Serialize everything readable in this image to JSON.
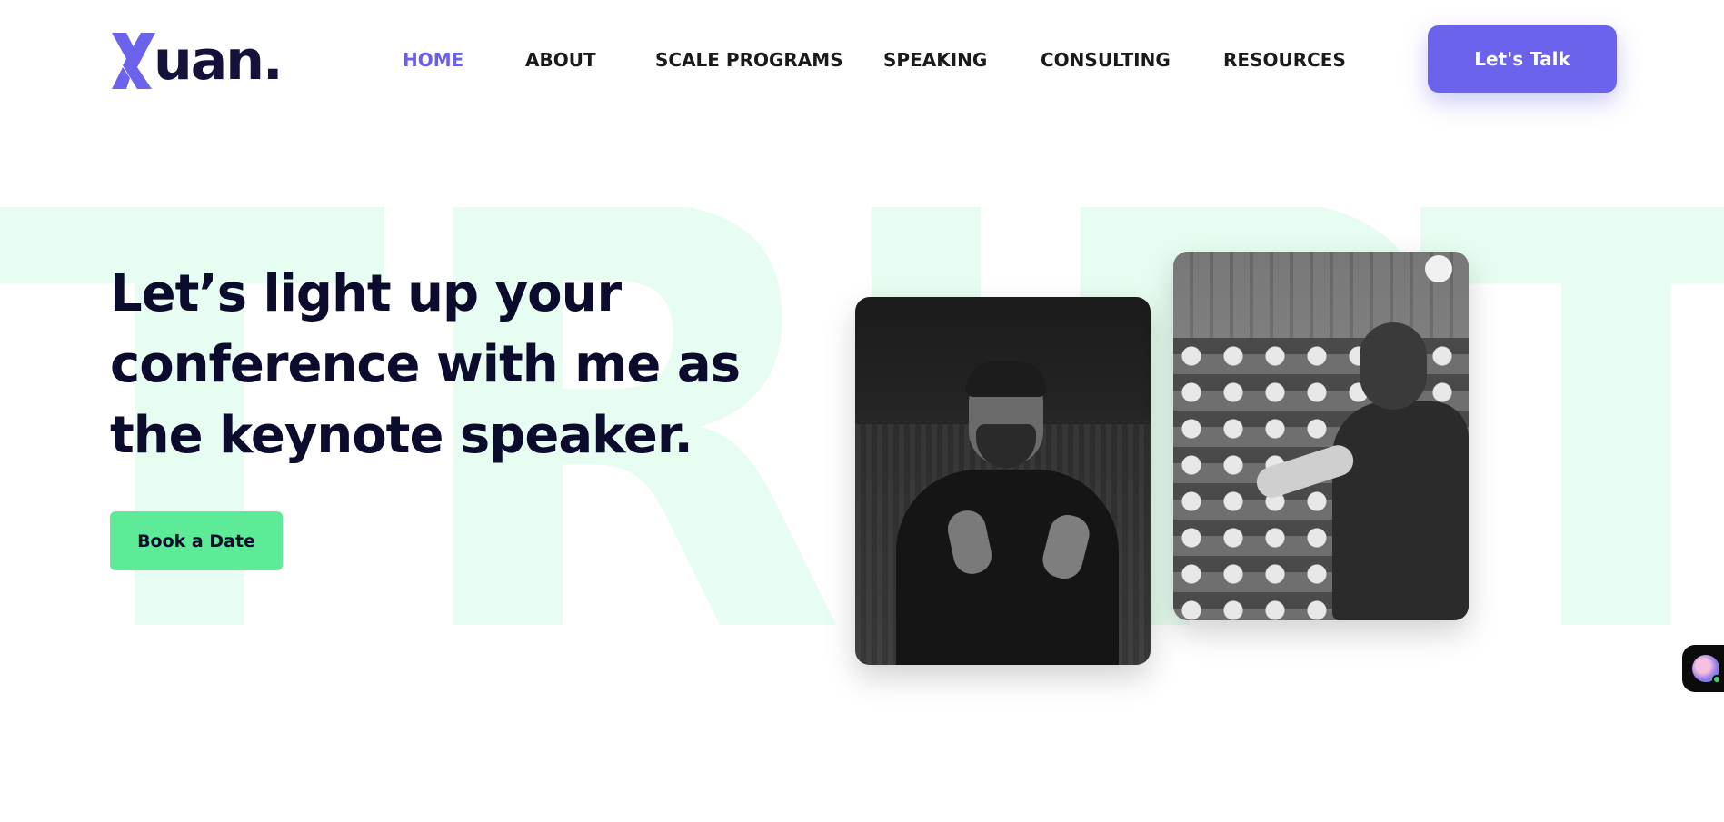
{
  "brand": {
    "logo_text": "uan",
    "logo_dot": ".",
    "mark_color": "#6b63ec",
    "text_color": "#14123a"
  },
  "nav": {
    "items": [
      {
        "label": "HOME",
        "active": true
      },
      {
        "label": "ABOUT",
        "active": false
      },
      {
        "label": "SCALE PROGRAMS",
        "active": false
      },
      {
        "label": "SPEAKING",
        "active": false
      },
      {
        "label": "CONSULTING",
        "active": false
      },
      {
        "label": "RESOURCES",
        "active": false
      }
    ],
    "active_color": "#6a5fe8"
  },
  "header": {
    "cta_label": "Let's Talk",
    "cta_color": "#6b63ec"
  },
  "hero": {
    "background_letters": [
      "T",
      "R",
      "I",
      "P",
      "T"
    ],
    "background_letter_color": "#e8fdf1",
    "headline": "Let’s light up your conference with me as the keynote speaker.",
    "book_button_label": "Book a Date",
    "book_button_color": "#5eeb97"
  },
  "images": {
    "photo_1": "speaker-portrait-bw",
    "photo_2": "speaker-audience-bw"
  },
  "widgets": {
    "chat_icon": "chat-avatar-icon",
    "status_color": "#3ed27a"
  }
}
